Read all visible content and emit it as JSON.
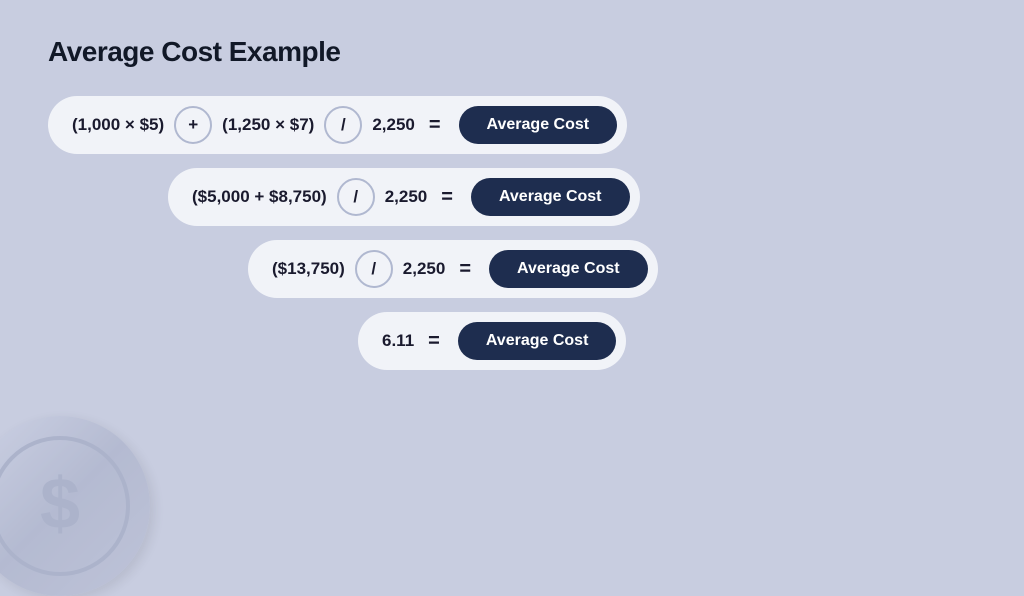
{
  "page": {
    "title": "Average Cost Example",
    "background": "#c8cde0"
  },
  "equations": [
    {
      "id": "row-1",
      "parts": [
        "(1,000  ×  $5)",
        "+",
        "(1,250  ×  $7)",
        "/",
        "2,250",
        "="
      ],
      "result": "Average Cost"
    },
    {
      "id": "row-2",
      "parts": [
        "($5,000  +  $8,750)",
        "/",
        "2,250",
        "="
      ],
      "result": "Average Cost"
    },
    {
      "id": "row-3",
      "parts": [
        "($13,750)",
        "/",
        "2,250",
        "="
      ],
      "result": "Average Cost"
    },
    {
      "id": "row-4",
      "parts": [
        "6.11",
        "="
      ],
      "result": "Average Cost"
    }
  ],
  "labels": {
    "plus": "+",
    "divide": "/",
    "equals": "="
  }
}
